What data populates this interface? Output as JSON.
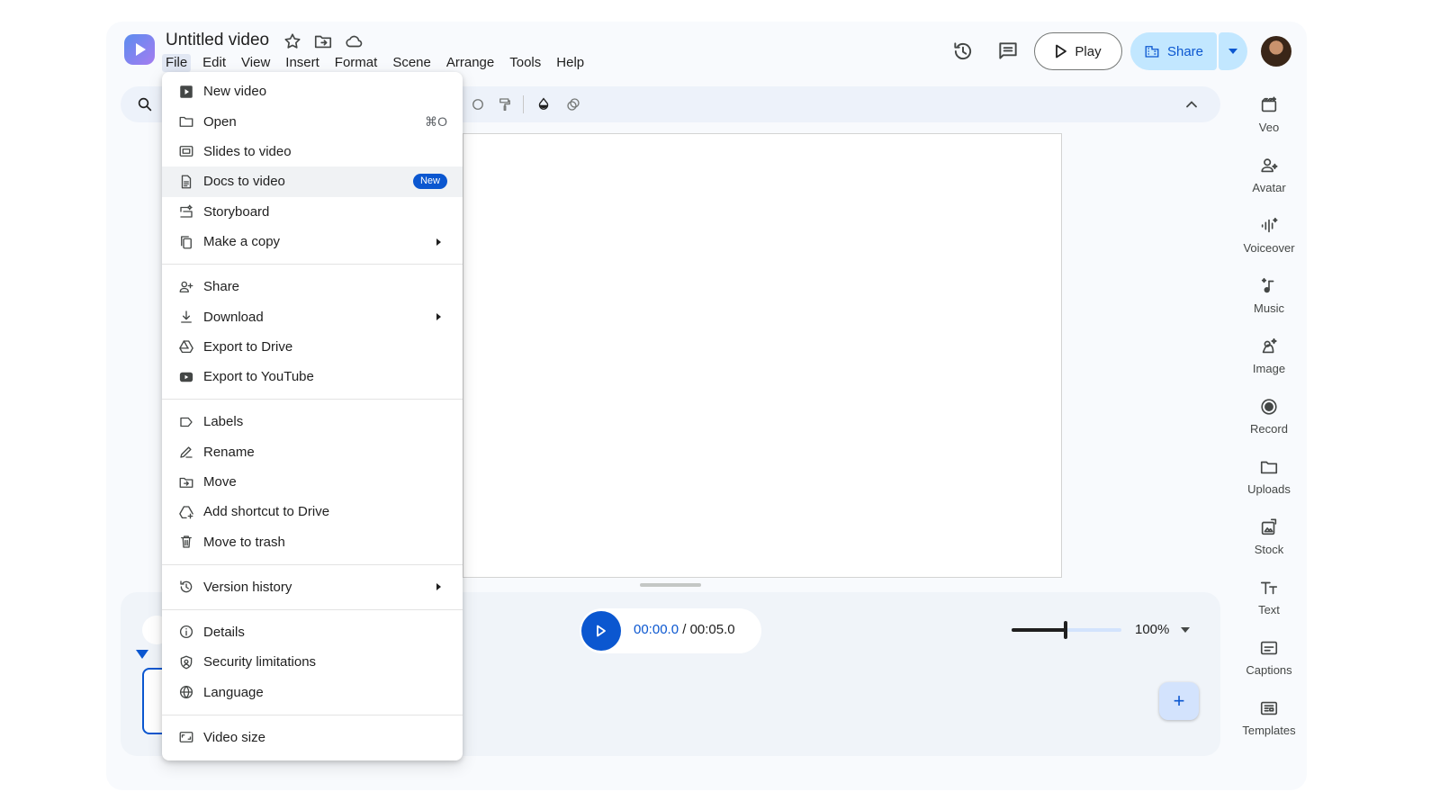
{
  "header": {
    "title": "Untitled video",
    "menus": [
      "File",
      "Edit",
      "View",
      "Insert",
      "Format",
      "Scene",
      "Arrange",
      "Tools",
      "Help"
    ],
    "active_menu": "File",
    "play_label": "Play",
    "share_label": "Share"
  },
  "file_menu": {
    "groups": [
      [
        {
          "label": "New video",
          "icon": "video-icon"
        },
        {
          "label": "Open",
          "icon": "folder-icon",
          "shortcut": "⌘O"
        },
        {
          "label": "Slides to video",
          "icon": "slides-icon"
        },
        {
          "label": "Docs to video",
          "icon": "doc-icon",
          "badge": "New",
          "highlighted": true
        },
        {
          "label": "Storyboard",
          "icon": "storyboard-icon"
        },
        {
          "label": "Make a copy",
          "icon": "copy-icon",
          "submenu": true
        }
      ],
      [
        {
          "label": "Share",
          "icon": "person-add-icon"
        },
        {
          "label": "Download",
          "icon": "download-icon",
          "submenu": true
        },
        {
          "label": "Export to Drive",
          "icon": "drive-icon"
        },
        {
          "label": "Export to YouTube",
          "icon": "youtube-icon"
        }
      ],
      [
        {
          "label": "Labels",
          "icon": "label-icon"
        },
        {
          "label": "Rename",
          "icon": "pencil-icon"
        },
        {
          "label": "Move",
          "icon": "folder-move-icon"
        },
        {
          "label": "Add shortcut to Drive",
          "icon": "drive-shortcut-icon"
        },
        {
          "label": "Move to trash",
          "icon": "trash-icon"
        }
      ],
      [
        {
          "label": "Version history",
          "icon": "history-icon",
          "submenu": true
        }
      ],
      [
        {
          "label": "Details",
          "icon": "info-icon"
        },
        {
          "label": "Security limitations",
          "icon": "shield-icon"
        },
        {
          "label": "Language",
          "icon": "globe-icon"
        }
      ],
      [
        {
          "label": "Video size",
          "icon": "aspect-ratio-icon"
        }
      ]
    ]
  },
  "timeline": {
    "current_time": "00:00.0",
    "separator": " / ",
    "total_time": "00:05.0",
    "zoom_label": "100%",
    "zoom_fraction": 0.49,
    "add_label": "+"
  },
  "rail": {
    "items": [
      {
        "label": "Veo",
        "icon": "veo-icon"
      },
      {
        "label": "Avatar",
        "icon": "avatar-icon"
      },
      {
        "label": "Voiceover",
        "icon": "voiceover-icon"
      },
      {
        "label": "Music",
        "icon": "music-icon"
      },
      {
        "label": "Image",
        "icon": "image-icon"
      },
      {
        "label": "Record",
        "icon": "record-icon"
      },
      {
        "label": "Uploads",
        "icon": "uploads-icon"
      },
      {
        "label": "Stock",
        "icon": "stock-icon"
      },
      {
        "label": "Text",
        "icon": "text-icon"
      },
      {
        "label": "Captions",
        "icon": "captions-icon"
      },
      {
        "label": "Templates",
        "icon": "templates-icon"
      }
    ]
  },
  "colors": {
    "accent": "#0b57d0",
    "share_bg": "#c2e7ff",
    "surface": "#f8fafd"
  }
}
